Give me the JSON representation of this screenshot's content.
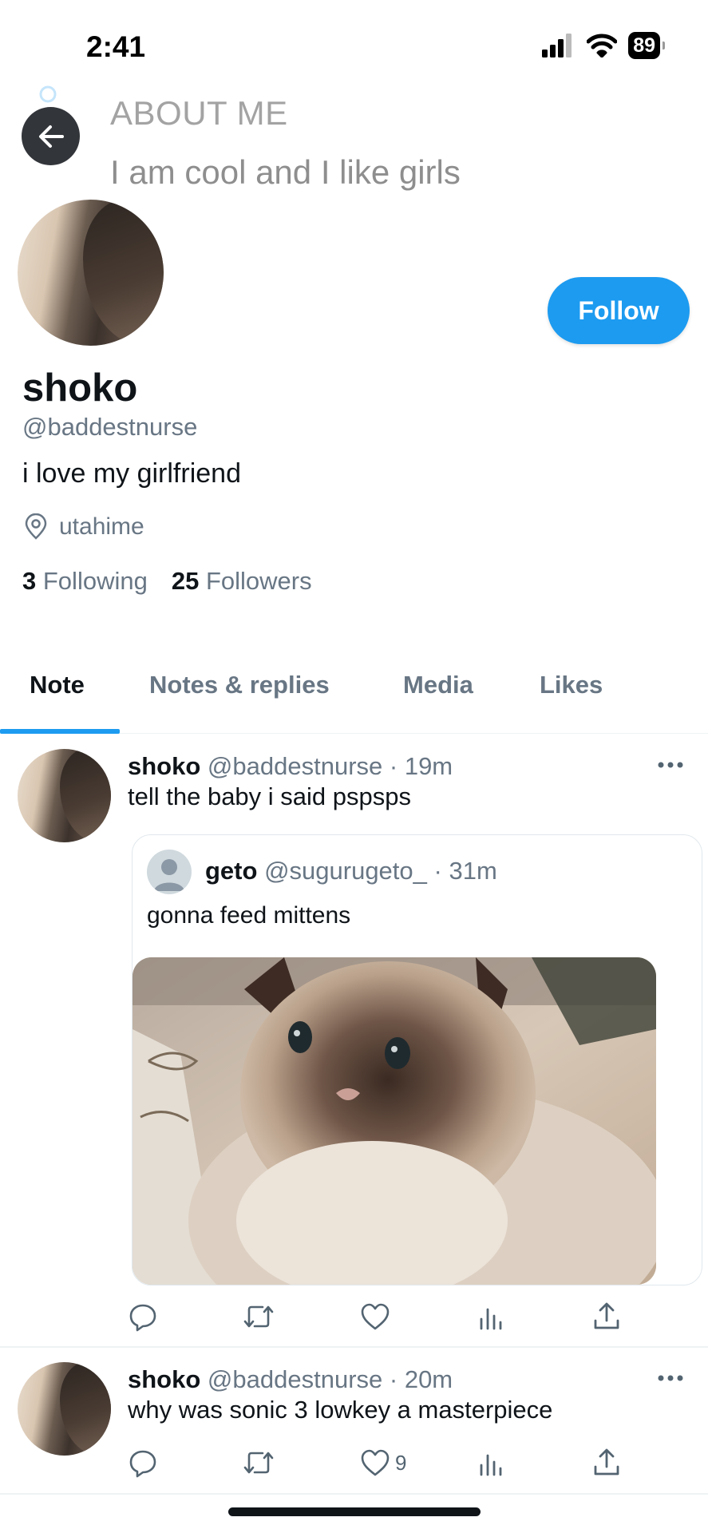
{
  "status_bar": {
    "time": "2:41",
    "battery": "89"
  },
  "header": {
    "about_title": "ABOUT ME",
    "about_text": "I am cool and I like girls"
  },
  "profile": {
    "name": "shoko",
    "handle": "@baddestnurse",
    "bio": "i love my girlfriend",
    "location": "utahime",
    "following_count": "3",
    "following_label": "Following",
    "followers_count": "25",
    "followers_label": "Followers",
    "follow_label": "Follow"
  },
  "tabs": [
    {
      "label": "Note",
      "active": true
    },
    {
      "label": "Notes & replies",
      "active": false
    },
    {
      "label": "Media",
      "active": false
    },
    {
      "label": "Likes",
      "active": false
    }
  ],
  "posts": [
    {
      "name": "shoko",
      "handle": "@baddestnurse",
      "time": "· 19m",
      "text": "tell the baby i said pspsps",
      "quote": {
        "name": "geto",
        "handle": "@sugurugeto_",
        "time": "· 31m",
        "text": "gonna feed mittens"
      }
    },
    {
      "name": "shoko",
      "handle": "@baddestnurse",
      "time": "· 20m",
      "text": "why was sonic 3 lowkey a masterpiece",
      "likes": "9"
    }
  ],
  "colors": {
    "accent": "#1d9bf0",
    "text": "#0f1419",
    "muted": "#687684"
  },
  "icons": [
    "back-arrow-icon",
    "location-pin-icon",
    "reply-icon",
    "retweet-icon",
    "like-icon",
    "views-icon",
    "share-icon",
    "more-icon"
  ]
}
